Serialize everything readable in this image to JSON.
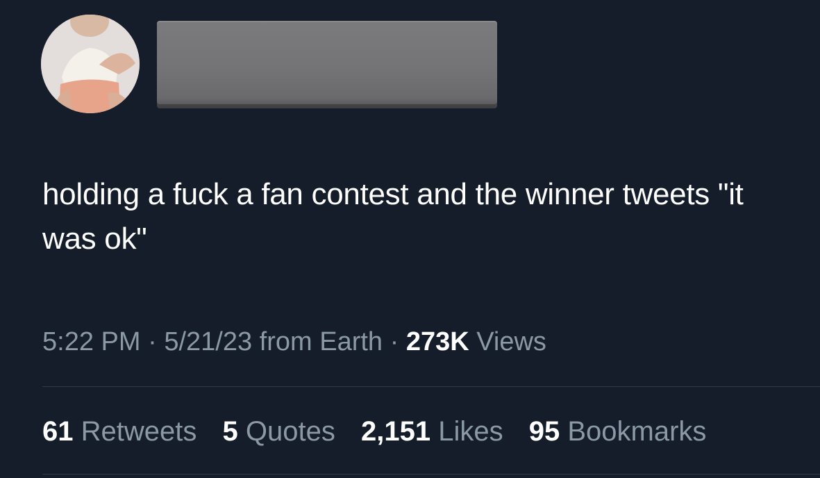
{
  "tweet": {
    "text": "holding a fuck a fan contest and the winner tweets \"it was ok\"",
    "time": "5:22 PM",
    "separator": "·",
    "date": "5/21/23",
    "source": "from Earth",
    "views_count": "273K",
    "views_label": "Views"
  },
  "stats": {
    "retweets_count": "61",
    "retweets_label": "Retweets",
    "quotes_count": "5",
    "quotes_label": "Quotes",
    "likes_count": "2,151",
    "likes_label": "Likes",
    "bookmarks_count": "95",
    "bookmarks_label": "Bookmarks"
  },
  "colors": {
    "background": "#151d2a",
    "text_primary": "#ffffff",
    "text_secondary": "#8b98a5",
    "divider": "#2f3a48",
    "redaction": "#747477"
  }
}
